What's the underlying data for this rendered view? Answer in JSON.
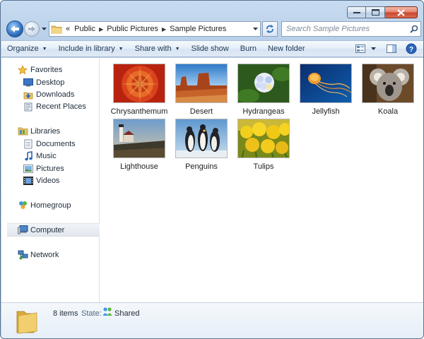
{
  "address": {
    "overflow_chevron": "«",
    "crumbs": [
      "Public",
      "Public Pictures",
      "Sample Pictures"
    ]
  },
  "search": {
    "placeholder": "Search Sample Pictures"
  },
  "toolbar": {
    "organize": "Organize",
    "include_in_library": "Include in library",
    "share_with": "Share with",
    "slide_show": "Slide show",
    "burn": "Burn",
    "new_folder": "New folder"
  },
  "nav": {
    "favorites": "Favorites",
    "desktop": "Desktop",
    "downloads": "Downloads",
    "recent_places": "Recent Places",
    "libraries": "Libraries",
    "documents": "Documents",
    "music": "Music",
    "pictures": "Pictures",
    "videos": "Videos",
    "homegroup": "Homegroup",
    "computer": "Computer",
    "network": "Network",
    "selected": "computer"
  },
  "files": [
    {
      "name": "Chrysanthemum",
      "icon": "chrysanthemum-thumbnail"
    },
    {
      "name": "Desert",
      "icon": "desert-thumbnail"
    },
    {
      "name": "Hydrangeas",
      "icon": "hydrangeas-thumbnail"
    },
    {
      "name": "Jellyfish",
      "icon": "jellyfish-thumbnail"
    },
    {
      "name": "Koala",
      "icon": "koala-thumbnail"
    },
    {
      "name": "Lighthouse",
      "icon": "lighthouse-thumbnail"
    },
    {
      "name": "Penguins",
      "icon": "penguins-thumbnail"
    },
    {
      "name": "Tulips",
      "icon": "tulips-thumbnail"
    }
  ],
  "details": {
    "item_count": "8 items",
    "state_label": "State:",
    "state_value": "Shared"
  },
  "colors": {
    "chrome": "#bcd2ea",
    "commandbar": "#dfe9f5",
    "close_button": "#c9452c",
    "nav_text": "#1e3954"
  }
}
